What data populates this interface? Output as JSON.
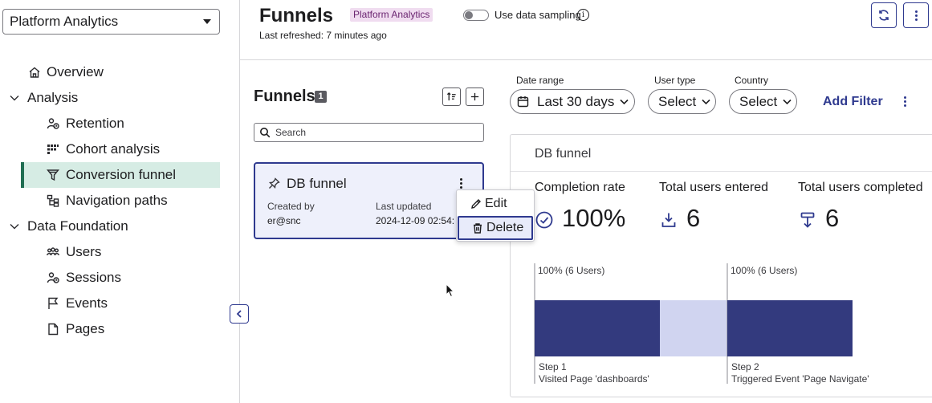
{
  "sidebar": {
    "app_select": "Platform Analytics",
    "items": [
      {
        "label": "Overview",
        "icon": "home-icon"
      },
      {
        "label": "Analysis",
        "icon": "chevron-down-icon"
      },
      {
        "label": "Retention",
        "icon": "retention-icon"
      },
      {
        "label": "Cohort analysis",
        "icon": "cohort-icon"
      },
      {
        "label": "Conversion funnel",
        "icon": "funnel-icon",
        "active": true
      },
      {
        "label": "Navigation paths",
        "icon": "navigation-paths-icon"
      },
      {
        "label": "Data Foundation",
        "icon": "chevron-down-icon"
      },
      {
        "label": "Users",
        "icon": "users-icon"
      },
      {
        "label": "Sessions",
        "icon": "sessions-icon"
      },
      {
        "label": "Events",
        "icon": "flag-icon"
      },
      {
        "label": "Pages",
        "icon": "page-icon"
      }
    ]
  },
  "header": {
    "title": "Funnels",
    "app_badge": "Platform Analytics",
    "sampling_label": "Use data sampling",
    "sampling_enabled": false,
    "refreshed": "Last refreshed: 7 minutes ago"
  },
  "funnels_panel": {
    "title": "Funnels",
    "count": "1",
    "search_placeholder": "Search",
    "card": {
      "name": "DB funnel",
      "created_by_label": "Created by",
      "created_by": "er@snc",
      "updated_label": "Last updated",
      "updated": "2024-12-09 02:54:"
    },
    "menu": {
      "edit": "Edit",
      "delete": "Delete"
    }
  },
  "filters": {
    "date_range_label": "Date range",
    "date_range_value": "Last 30 days",
    "user_type_label": "User type",
    "user_type_value": "Select",
    "country_label": "Country",
    "country_value": "Select",
    "add_filter": "Add Filter"
  },
  "detail": {
    "title": "DB funnel",
    "stats": {
      "completion_label": "Completion rate",
      "completion_value": "100%",
      "entered_label": "Total users entered",
      "entered_value": "6",
      "completed_label": "Total users completed",
      "completed_value": "6"
    }
  },
  "colors": {
    "primary": "#2f3a8f",
    "bar": "#333a7e",
    "bar_light": "#d0d4f0",
    "active_nav_bg": "#d6ece4",
    "active_nav_bar": "#1f6e52",
    "badge_bg": "#f0dcf0"
  },
  "chart_data": {
    "type": "bar",
    "categories": [
      "Step 1",
      "Step 2"
    ],
    "step_names": [
      "Visited Page 'dashboards'",
      "Triggered Event 'Page Navigate'"
    ],
    "values": [
      6,
      6
    ],
    "value_labels": [
      "100% (6 Users)",
      "100% (6 Users)"
    ],
    "ylim": [
      0,
      6
    ]
  }
}
